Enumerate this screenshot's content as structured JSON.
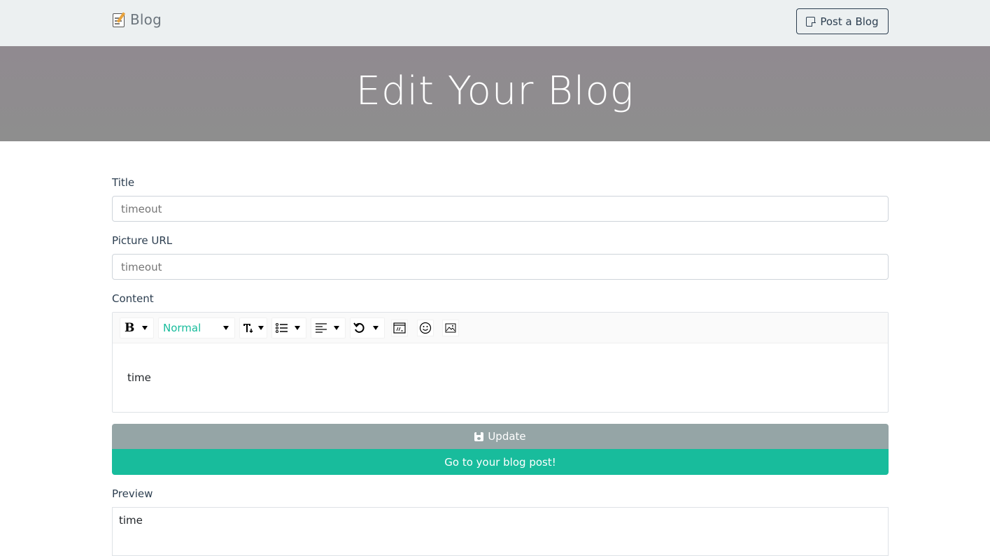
{
  "navbar": {
    "brand": "Blog",
    "post_button": "Post a Blog"
  },
  "hero": {
    "title": "Edit Your Blog"
  },
  "form": {
    "title_label": "Title",
    "title_placeholder": "timeout",
    "picture_label": "Picture URL",
    "picture_placeholder": "timeout",
    "content_label": "Content",
    "toolbar": {
      "block_type": "Normal",
      "icons": [
        "bold-icon",
        "font-size-icon",
        "list-icon",
        "align-icon",
        "undo-icon",
        "embed-icon",
        "emoji-icon",
        "image-icon"
      ]
    },
    "content_text": "time"
  },
  "buttons": {
    "update": "Update",
    "go": "Go to your blog post!"
  },
  "preview": {
    "label": "Preview",
    "text": "time"
  },
  "colors": {
    "accent": "#18bc9c",
    "secondary": "#95a5a6",
    "nav_bg": "#ecf0f1",
    "dark": "#2c3e50"
  }
}
